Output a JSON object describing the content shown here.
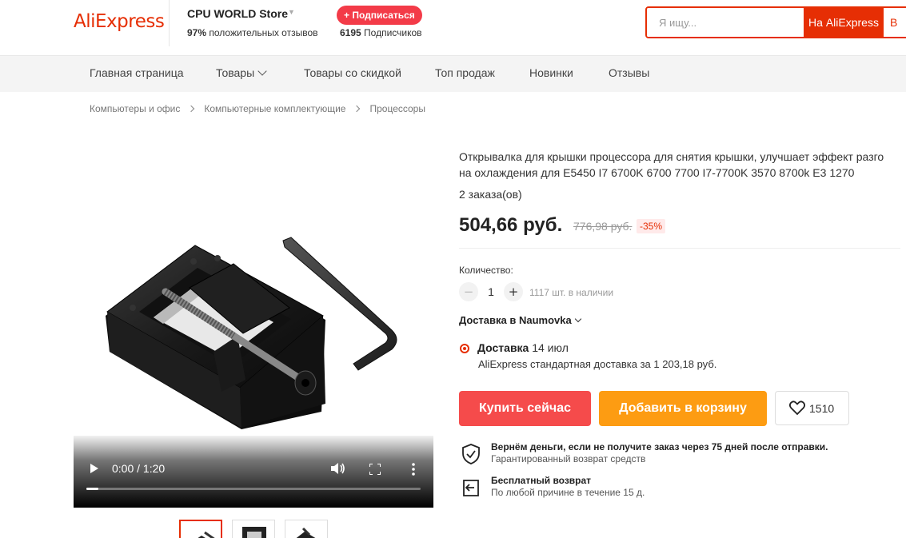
{
  "header": {
    "logo": "AliExpress",
    "store_name": "CPU WORLD Store",
    "rating_percent": "97%",
    "rating_text": "положительных отзывов",
    "subscribe_label": "+ Подписаться",
    "followers_count": "6195",
    "followers_text": "Подписчиков",
    "search_placeholder": "Я ищу...",
    "search_button": "На AliExpress",
    "search_button2": "В"
  },
  "nav": {
    "items": [
      "Главная страница",
      "Товары",
      "Товары со скидкой",
      "Топ продаж",
      "Новинки",
      "Отзывы"
    ]
  },
  "breadcrumb": [
    "Компьютеры и офис",
    "Компьютерные комплектующие",
    "Процессоры"
  ],
  "video": {
    "time": "0:00 / 1:20",
    "progress": 0.035
  },
  "product": {
    "title": "Открывалка для крышки процессора для снятия крышки, улучшает эффект разго на охлаждения для E5450 I7 6700K 6700 7700 I7-7700K 3570 8700k E3 1270",
    "orders": "2 заказа(ов)",
    "price": "504,66 руб.",
    "old_price": "776,98 руб.",
    "discount": "-35%",
    "quantity_label": "Количество:",
    "quantity_minus": "−",
    "quantity_value": "1",
    "quantity_plus": "+",
    "stock": "1117 шт. в наличии",
    "ship_to": "Доставка в Naumovka",
    "delivery_label": "Доставка",
    "delivery_date": "14 июл",
    "delivery_desc": "AliExpress стандартная доставка за 1 203,18 руб.",
    "buy_now": "Купить сейчас",
    "add_to_cart": "Добавить в корзину",
    "wishlist_count": "1510"
  },
  "guarantees": [
    {
      "title": "Вернём деньги, если не получите заказ через 75 дней после отправки.",
      "subtitle": "Гарантированный возврат средств"
    },
    {
      "title": "Бесплатный возврат",
      "subtitle": "По любой причине в течение 15 д."
    }
  ],
  "colors": {
    "brand": "#e62e04",
    "buy": "#f54b4b",
    "cart": "#fd9c12"
  }
}
